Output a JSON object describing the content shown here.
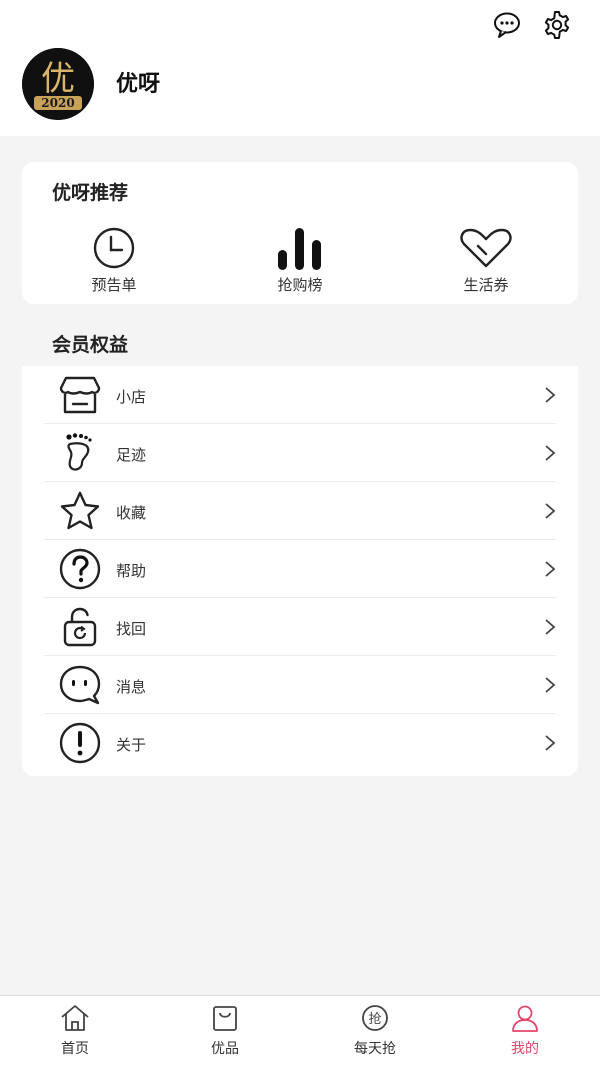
{
  "header": {
    "username": "优呀",
    "avatar": {
      "glyph": "优",
      "year": "2020"
    },
    "icons": [
      "message-icon",
      "settings-icon"
    ]
  },
  "recommend": {
    "title": "优呀推荐",
    "items": [
      {
        "label": "预告单",
        "icon": "clock-icon"
      },
      {
        "label": "抢购榜",
        "icon": "bar-chart-icon"
      },
      {
        "label": "生活券",
        "icon": "heart-icon"
      }
    ]
  },
  "member": {
    "title": "会员权益",
    "items": [
      {
        "label": "小店",
        "icon": "shop-icon"
      },
      {
        "label": "足迹",
        "icon": "footprint-icon"
      },
      {
        "label": "收藏",
        "icon": "star-icon"
      },
      {
        "label": "帮助",
        "icon": "help-icon"
      },
      {
        "label": "找回",
        "icon": "lock-refresh-icon"
      },
      {
        "label": "消息",
        "icon": "chat-icon"
      },
      {
        "label": "关于",
        "icon": "info-icon"
      }
    ]
  },
  "nav": {
    "items": [
      {
        "label": "首页",
        "icon": "home-icon"
      },
      {
        "label": "优品",
        "icon": "bag-icon"
      },
      {
        "label": "每天抢",
        "icon": "grab-icon",
        "icon_text": "抢"
      },
      {
        "label": "我的",
        "icon": "user-icon",
        "active": true
      }
    ],
    "active_color": "#e2456b"
  }
}
